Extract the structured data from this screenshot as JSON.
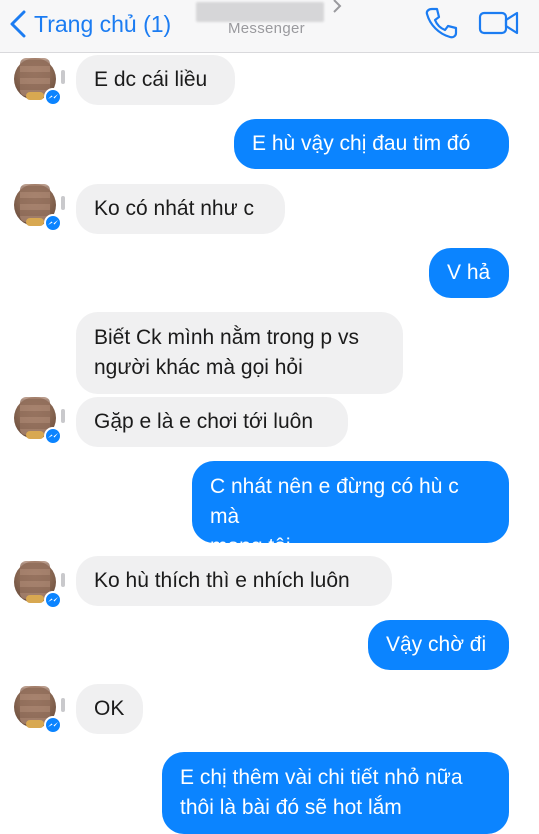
{
  "header": {
    "back_label": "Trang chủ (1)",
    "subtitle": "Messenger",
    "colors": {
      "accent": "#1b7cf2",
      "header_bg": "#f7f7f8"
    },
    "icons": [
      "chevron-left-icon",
      "phone-icon",
      "video-camera-icon"
    ]
  },
  "colors": {
    "incoming_bubble": "#f0f0f1",
    "outgoing_bubble": "#0b84ff"
  },
  "messages": [
    {
      "from": "them",
      "text": "E dc cái liều"
    },
    {
      "from": "me",
      "text": "E hù vậy chị đau tim đó"
    },
    {
      "from": "them",
      "text": "Ko có nhát như c"
    },
    {
      "from": "me",
      "text": "V hả"
    },
    {
      "from": "them",
      "text": "Biết Ck mình nằm trong p vs\nngười khác mà gọi hỏi"
    },
    {
      "from": "them",
      "text": "Gặp e là e chơi tới luôn"
    },
    {
      "from": "me",
      "text": "C nhát nên e đừng có hù c mà\nmang tội"
    },
    {
      "from": "them",
      "text": "Ko hù thích thì e nhích luôn"
    },
    {
      "from": "me",
      "text": "Vậy chờ đi"
    },
    {
      "from": "them",
      "text": "OK"
    },
    {
      "from": "me",
      "text": "E chị thêm vài chi tiết nhỏ nữa\nthôi là bài đó sẽ hot lắm"
    }
  ]
}
